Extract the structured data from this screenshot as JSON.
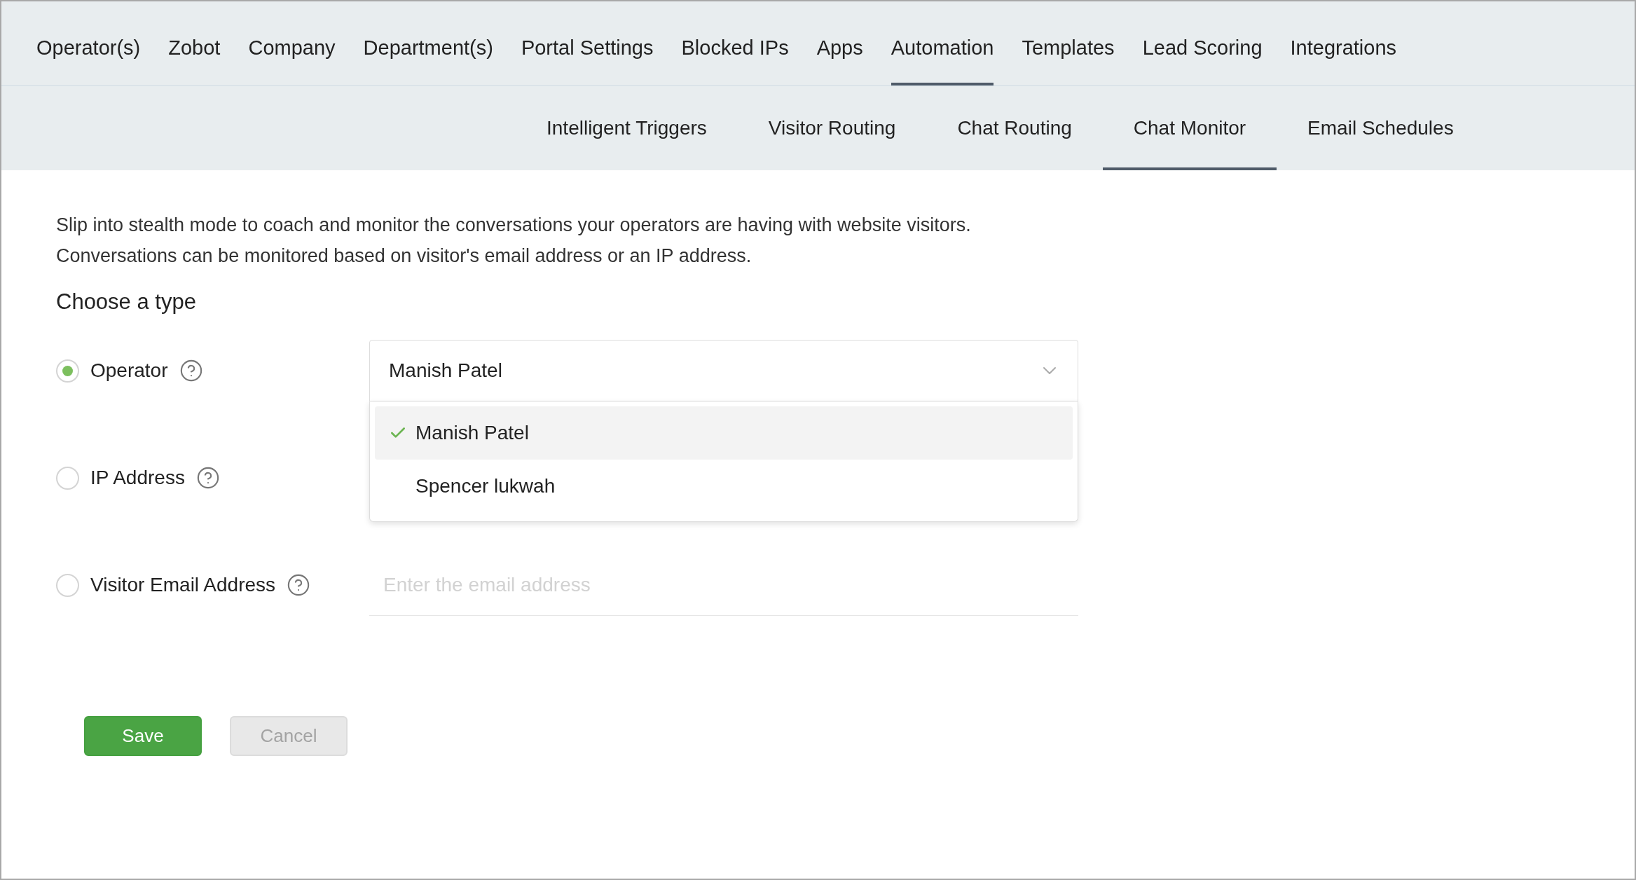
{
  "main_tabs": [
    {
      "label": "Operator(s)",
      "selected": false
    },
    {
      "label": "Zobot",
      "selected": false
    },
    {
      "label": "Company",
      "selected": false
    },
    {
      "label": "Department(s)",
      "selected": false
    },
    {
      "label": "Portal Settings",
      "selected": false
    },
    {
      "label": "Blocked IPs",
      "selected": false
    },
    {
      "label": "Apps",
      "selected": false
    },
    {
      "label": "Automation",
      "selected": true
    },
    {
      "label": "Templates",
      "selected": false
    },
    {
      "label": "Lead Scoring",
      "selected": false
    },
    {
      "label": "Integrations",
      "selected": false
    }
  ],
  "sub_tabs": [
    {
      "label": "Intelligent Triggers",
      "selected": false
    },
    {
      "label": "Visitor Routing",
      "selected": false
    },
    {
      "label": "Chat Routing",
      "selected": false
    },
    {
      "label": "Chat Monitor",
      "selected": true
    },
    {
      "label": "Email Schedules",
      "selected": false
    }
  ],
  "description": [
    "Slip into stealth mode to coach and monitor the conversations your operators are having with website visitors.",
    "Conversations can be monitored based on visitor's email address or an IP address."
  ],
  "section_title": "Choose a type",
  "types": [
    {
      "label": "Operator",
      "selected": true,
      "kind": "dropdown",
      "value": "Manish Patel",
      "expanded": true,
      "options": [
        {
          "label": "Manish Patel",
          "selected": true
        },
        {
          "label": "Spencer lukwah",
          "selected": false
        }
      ]
    },
    {
      "label": "IP Address",
      "selected": false,
      "kind": "hidden"
    },
    {
      "label": "Visitor Email Address",
      "selected": false,
      "kind": "input",
      "placeholder": "Enter the email address"
    }
  ],
  "buttons": [
    {
      "label": "Save",
      "kind": "primary"
    },
    {
      "label": "Cancel",
      "kind": "secondary"
    }
  ]
}
